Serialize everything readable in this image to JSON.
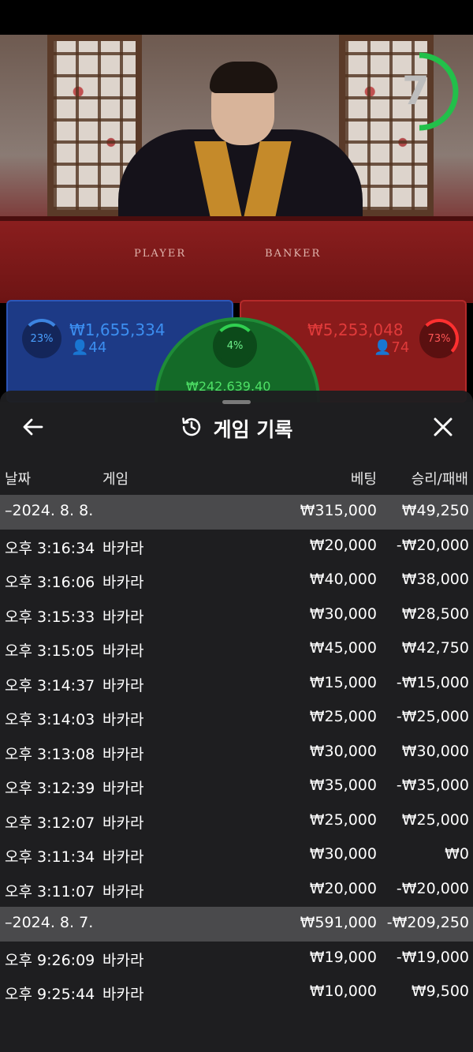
{
  "video": {
    "timer": "7",
    "felt_player": "PLAYER",
    "felt_banker": "BANKER"
  },
  "bets": {
    "player": {
      "percent": "23%",
      "amount": "₩1,655,334",
      "count": "44"
    },
    "banker": {
      "percent": "73%",
      "amount": "₩5,253,048",
      "count": "74"
    },
    "tie": {
      "percent": "4%",
      "amount": "₩242,639.40"
    }
  },
  "sheet": {
    "title": "게임 기록",
    "columns": {
      "date": "날짜",
      "game": "게임",
      "bet": "베팅",
      "result": "승리/패배"
    },
    "rows": [
      {
        "type": "group",
        "date": "–2024. 8. 8.",
        "game": "",
        "bet": "₩315,000",
        "result": "₩49,250"
      },
      {
        "type": "item",
        "date": "오후 3:16:34",
        "game": "바카라",
        "bet": "₩20,000",
        "result": "-₩20,000"
      },
      {
        "type": "item",
        "date": "오후 3:16:06",
        "game": "바카라",
        "bet": "₩40,000",
        "result": "₩38,000"
      },
      {
        "type": "item",
        "date": "오후 3:15:33",
        "game": "바카라",
        "bet": "₩30,000",
        "result": "₩28,500"
      },
      {
        "type": "item",
        "date": "오후 3:15:05",
        "game": "바카라",
        "bet": "₩45,000",
        "result": "₩42,750"
      },
      {
        "type": "item",
        "date": "오후 3:14:37",
        "game": "바카라",
        "bet": "₩15,000",
        "result": "-₩15,000"
      },
      {
        "type": "item",
        "date": "오후 3:14:03",
        "game": "바카라",
        "bet": "₩25,000",
        "result": "-₩25,000"
      },
      {
        "type": "item",
        "date": "오후 3:13:08",
        "game": "바카라",
        "bet": "₩30,000",
        "result": "₩30,000"
      },
      {
        "type": "item",
        "date": "오후 3:12:39",
        "game": "바카라",
        "bet": "₩35,000",
        "result": "-₩35,000"
      },
      {
        "type": "item",
        "date": "오후 3:12:07",
        "game": "바카라",
        "bet": "₩25,000",
        "result": "₩25,000"
      },
      {
        "type": "item",
        "date": "오후 3:11:34",
        "game": "바카라",
        "bet": "₩30,000",
        "result": "₩0"
      },
      {
        "type": "item",
        "date": "오후 3:11:07",
        "game": "바카라",
        "bet": "₩20,000",
        "result": "-₩20,000"
      },
      {
        "type": "group",
        "date": "–2024. 8. 7.",
        "game": "",
        "bet": "₩591,000",
        "result": "-₩209,250"
      },
      {
        "type": "item",
        "date": "오후 9:26:09",
        "game": "바카라",
        "bet": "₩19,000",
        "result": "-₩19,000"
      },
      {
        "type": "item",
        "date": "오후 9:25:44",
        "game": "바카라",
        "bet": "₩10,000",
        "result": "₩9,500"
      }
    ]
  },
  "colors": {
    "player_blue": "#3c8ef0",
    "banker_red": "#e03a3a",
    "tie_green": "#4ee066",
    "group_row": "#4a4a4c",
    "timer_green": "#22c04a"
  },
  "icons": {
    "back": "arrow-left-icon",
    "history": "history-icon",
    "close": "close-icon"
  }
}
